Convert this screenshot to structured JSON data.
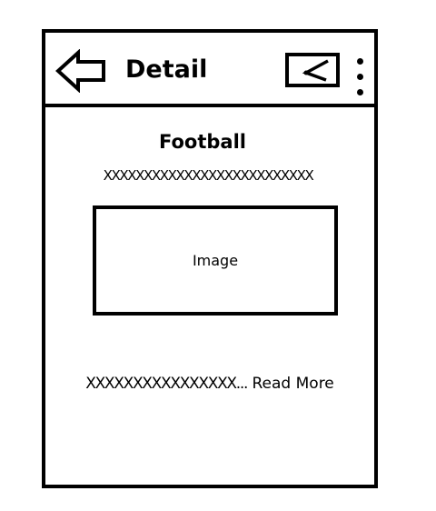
{
  "header": {
    "back_icon": "back-arrow-icon",
    "title": "Detail",
    "share_icon": "share-icon",
    "more_icon": "more-vertical-icon"
  },
  "content": {
    "title": "Football",
    "subtitle": "XXXXXXXXXXXXXXXXXXXXXXXXXX",
    "image_label": "Image",
    "summary": "XXXXXXXXXXXXXXXX...",
    "read_more": "Read More"
  }
}
